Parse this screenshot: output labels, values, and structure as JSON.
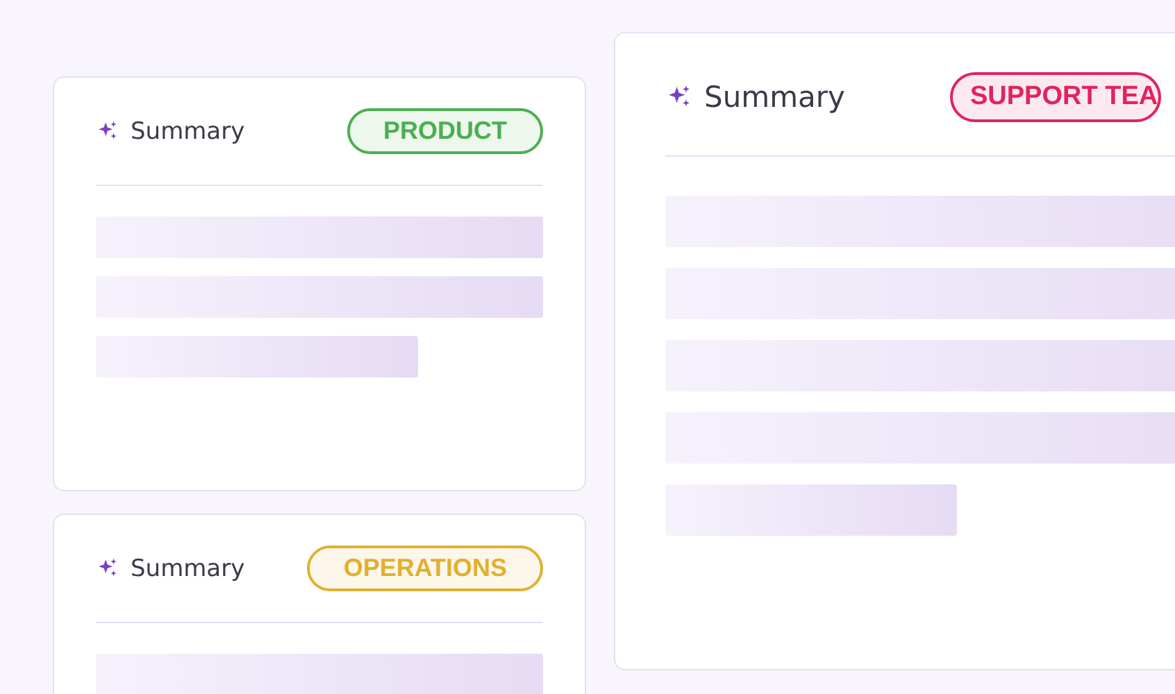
{
  "cards": [
    {
      "title": "Summary",
      "tag": {
        "label": "PRODUCT",
        "color": "#4caf50"
      },
      "kind": "compact",
      "lines": [
        {
          "kind": "full"
        },
        {
          "kind": "full"
        },
        {
          "kind": "short"
        }
      ]
    },
    {
      "title": "Summary",
      "tag": {
        "label": "OPERATIONS",
        "color": "#e0b030"
      },
      "kind": "compact",
      "lines": [
        {
          "kind": "full"
        }
      ]
    },
    {
      "title": "Summary",
      "tag": {
        "label": "SUPPORT TEA",
        "color": "#e0245e"
      },
      "kind": "wide",
      "lines": [
        {
          "kind": "full"
        },
        {
          "kind": "full"
        },
        {
          "kind": "full"
        },
        {
          "kind": "full"
        },
        {
          "kind": "short"
        }
      ]
    }
  ]
}
